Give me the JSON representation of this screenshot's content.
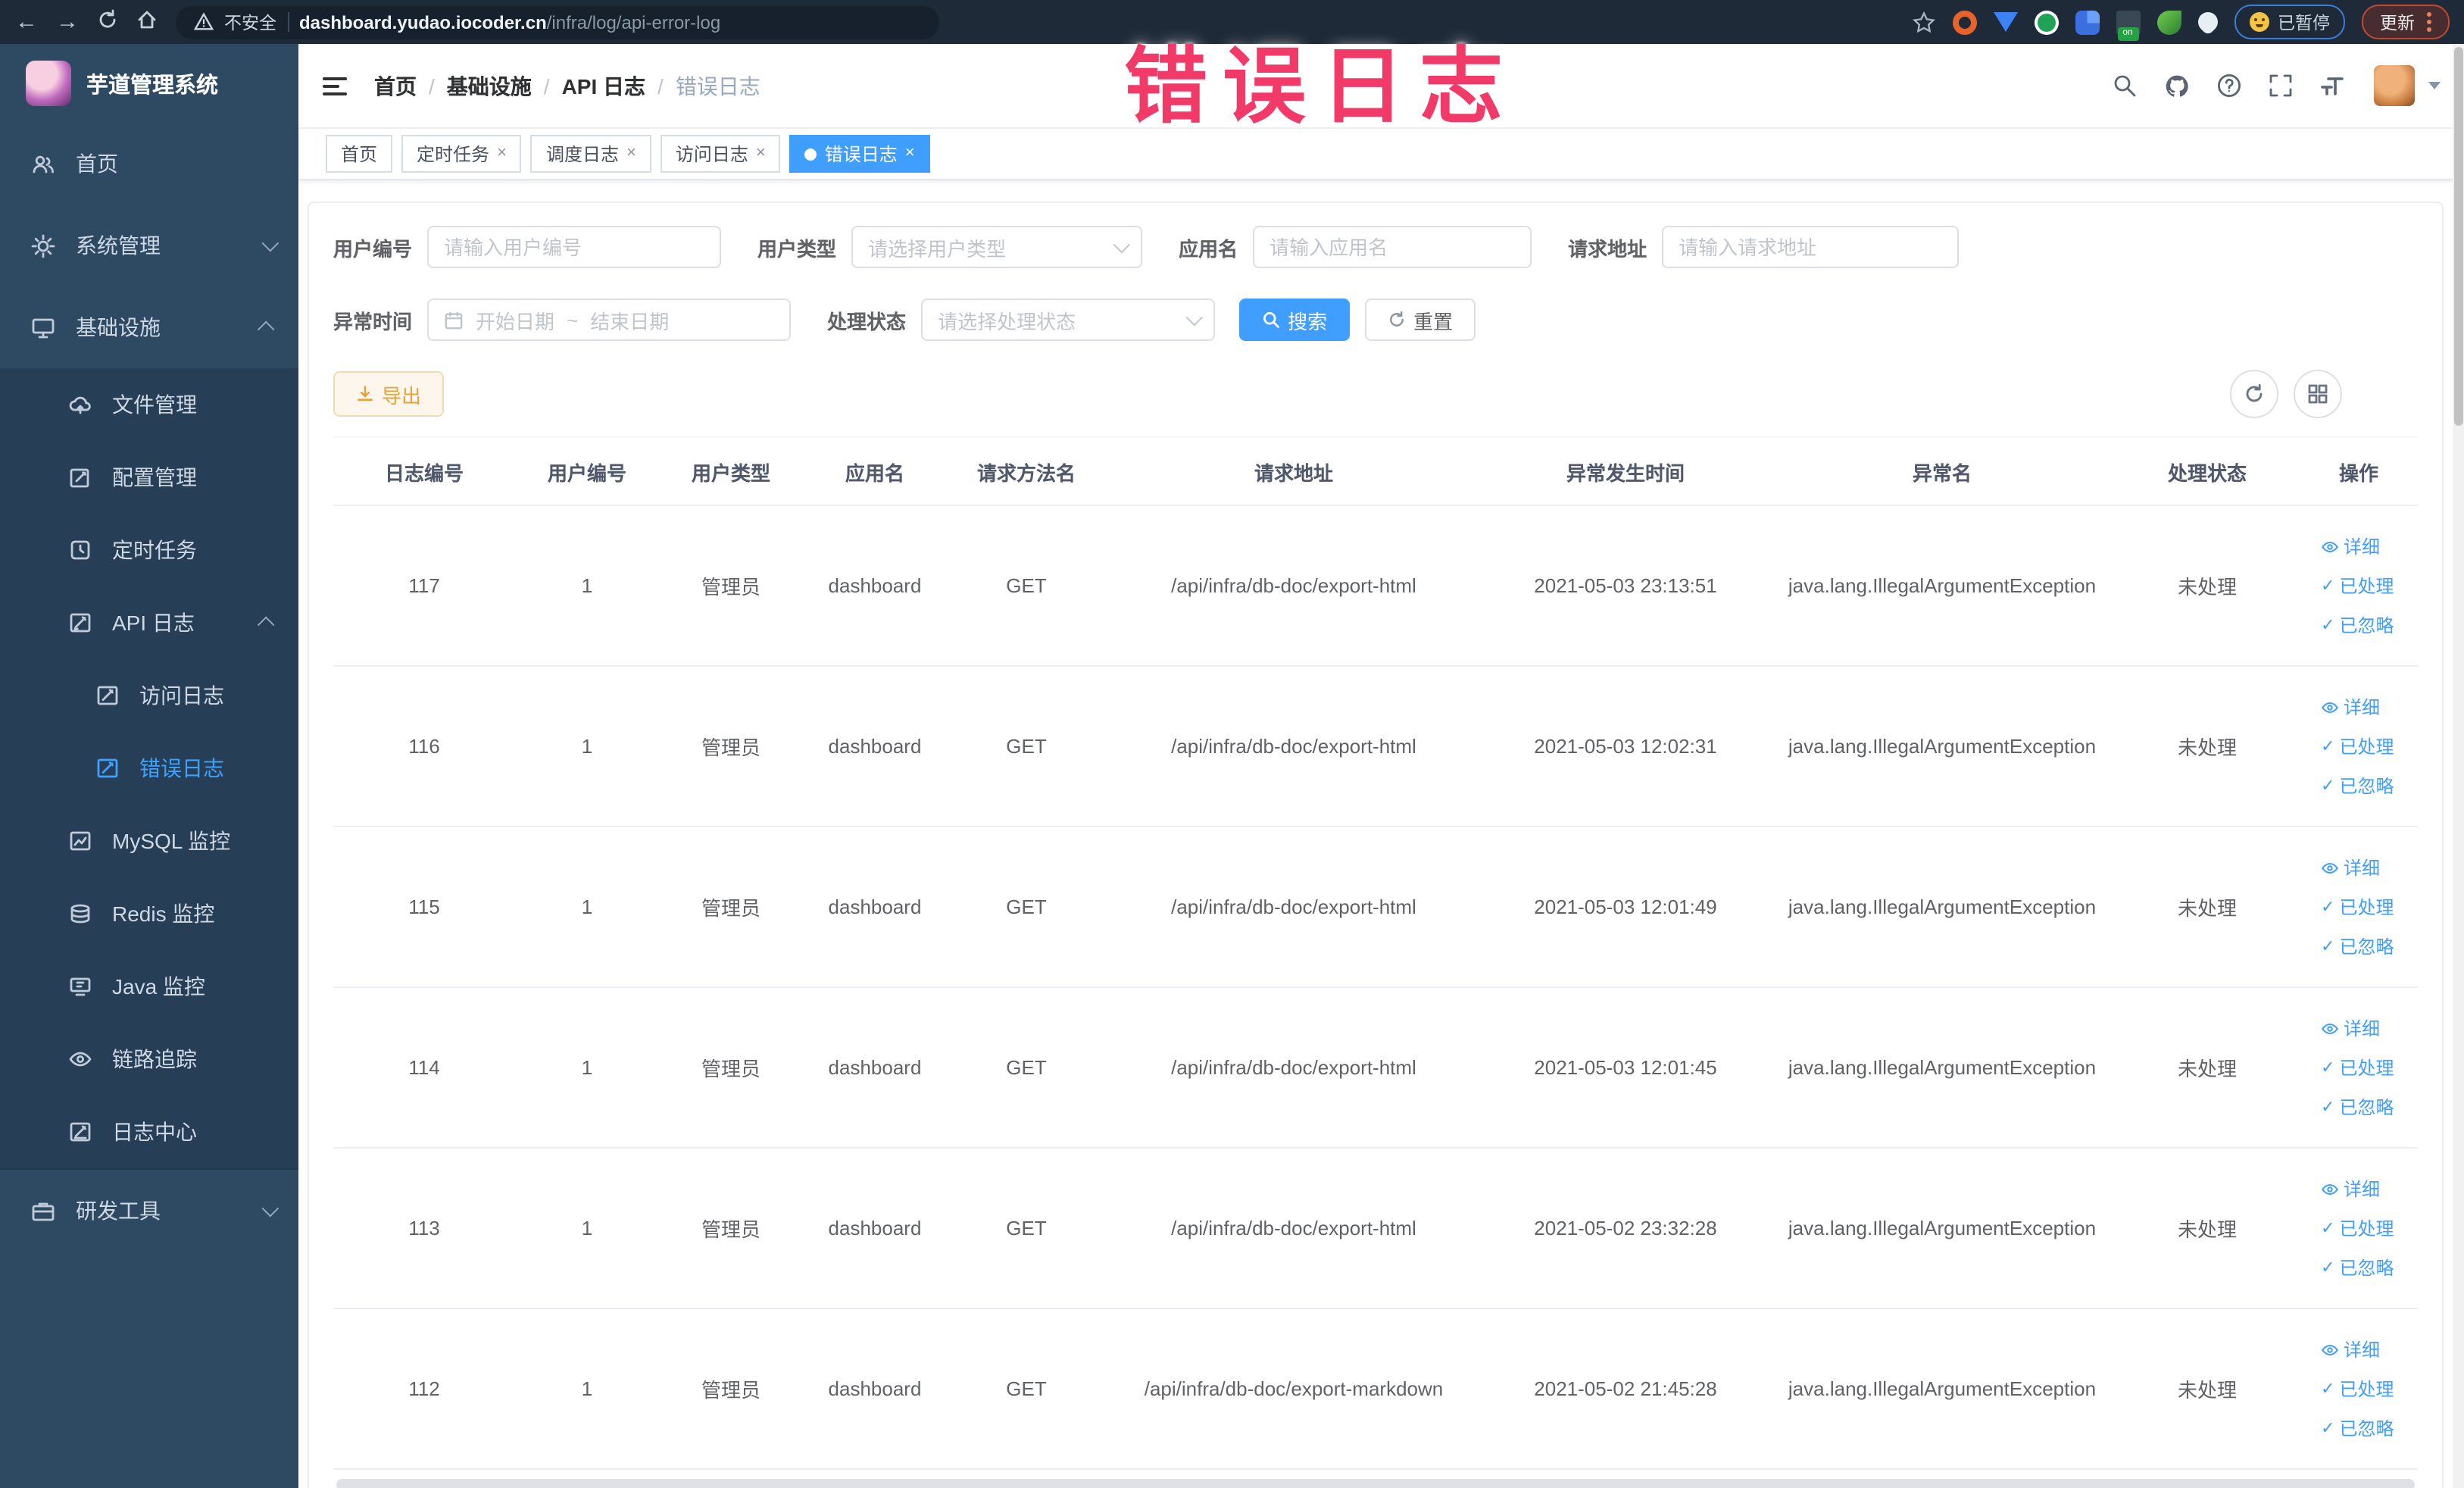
{
  "browser": {
    "security_label": "不安全",
    "url_host": "dashboard.yudao.iocoder.cn",
    "url_path": "/infra/log/api-error-log",
    "on_badge": "on",
    "paused_label": "已暂停",
    "update_label": "更新"
  },
  "annotation": {
    "text": "错误日志",
    "color": "#f23a68"
  },
  "sidebar": {
    "title": "芋道管理系统",
    "items": [
      {
        "label": "首页"
      },
      {
        "label": "系统管理"
      },
      {
        "label": "基础设施"
      },
      {
        "label": "文件管理"
      },
      {
        "label": "配置管理"
      },
      {
        "label": "定时任务"
      },
      {
        "label": "API 日志"
      },
      {
        "label": "访问日志"
      },
      {
        "label": "错误日志"
      },
      {
        "label": "MySQL 监控"
      },
      {
        "label": "Redis 监控"
      },
      {
        "label": "Java 监控"
      },
      {
        "label": "链路追踪"
      },
      {
        "label": "日志中心"
      },
      {
        "label": "研发工具"
      }
    ]
  },
  "header": {
    "breadcrumb": [
      "首页",
      "基础设施",
      "API 日志",
      "错误日志"
    ],
    "separator": "/"
  },
  "tabs": [
    {
      "label": "首页"
    },
    {
      "label": "定时任务"
    },
    {
      "label": "调度日志"
    },
    {
      "label": "访问日志"
    },
    {
      "label": "错误日志"
    }
  ],
  "filters": {
    "user_id": {
      "label": "用户编号",
      "placeholder": "请输入用户编号"
    },
    "user_type": {
      "label": "用户类型",
      "placeholder": "请选择用户类型"
    },
    "app_name": {
      "label": "应用名",
      "placeholder": "请输入应用名"
    },
    "request_url": {
      "label": "请求地址",
      "placeholder": "请输入请求地址"
    },
    "exception_time": {
      "label": "异常时间",
      "start_placeholder": "开始日期",
      "separator": "~",
      "end_placeholder": "结束日期"
    },
    "process_status": {
      "label": "处理状态",
      "placeholder": "请选择处理状态"
    },
    "search_label": "搜索",
    "reset_label": "重置"
  },
  "toolbar": {
    "export_label": "导出"
  },
  "table": {
    "columns": [
      "日志编号",
      "用户编号",
      "用户类型",
      "应用名",
      "请求方法名",
      "请求地址",
      "异常发生时间",
      "异常名",
      "处理状态",
      "操作"
    ],
    "action_labels": [
      "详细",
      "已处理",
      "已忽略"
    ],
    "rows": [
      {
        "id": "117",
        "user_id": "1",
        "user_type": "管理员",
        "app": "dashboard",
        "method": "GET",
        "url": "/api/infra/db-doc/export-html",
        "time": "2021-05-03 23:13:51",
        "exception": "java.lang.IllegalArgumentException",
        "status": "未处理"
      },
      {
        "id": "116",
        "user_id": "1",
        "user_type": "管理员",
        "app": "dashboard",
        "method": "GET",
        "url": "/api/infra/db-doc/export-html",
        "time": "2021-05-03 12:02:31",
        "exception": "java.lang.IllegalArgumentException",
        "status": "未处理"
      },
      {
        "id": "115",
        "user_id": "1",
        "user_type": "管理员",
        "app": "dashboard",
        "method": "GET",
        "url": "/api/infra/db-doc/export-html",
        "time": "2021-05-03 12:01:49",
        "exception": "java.lang.IllegalArgumentException",
        "status": "未处理"
      },
      {
        "id": "114",
        "user_id": "1",
        "user_type": "管理员",
        "app": "dashboard",
        "method": "GET",
        "url": "/api/infra/db-doc/export-html",
        "time": "2021-05-03 12:01:45",
        "exception": "java.lang.IllegalArgumentException",
        "status": "未处理"
      },
      {
        "id": "113",
        "user_id": "1",
        "user_type": "管理员",
        "app": "dashboard",
        "method": "GET",
        "url": "/api/infra/db-doc/export-html",
        "time": "2021-05-02 23:32:28",
        "exception": "java.lang.IllegalArgumentException",
        "status": "未处理"
      },
      {
        "id": "112",
        "user_id": "1",
        "user_type": "管理员",
        "app": "dashboard",
        "method": "GET",
        "url": "/api/infra/db-doc/export-markdown",
        "time": "2021-05-02 21:45:28",
        "exception": "java.lang.IllegalArgumentException",
        "status": "未处理"
      }
    ]
  },
  "colors": {
    "accent": "#409eff",
    "warning": "#e6a23c",
    "sidebar_bg": "#2e4a63",
    "submenu_bg": "#273f56",
    "annotation": "#f23a68"
  }
}
